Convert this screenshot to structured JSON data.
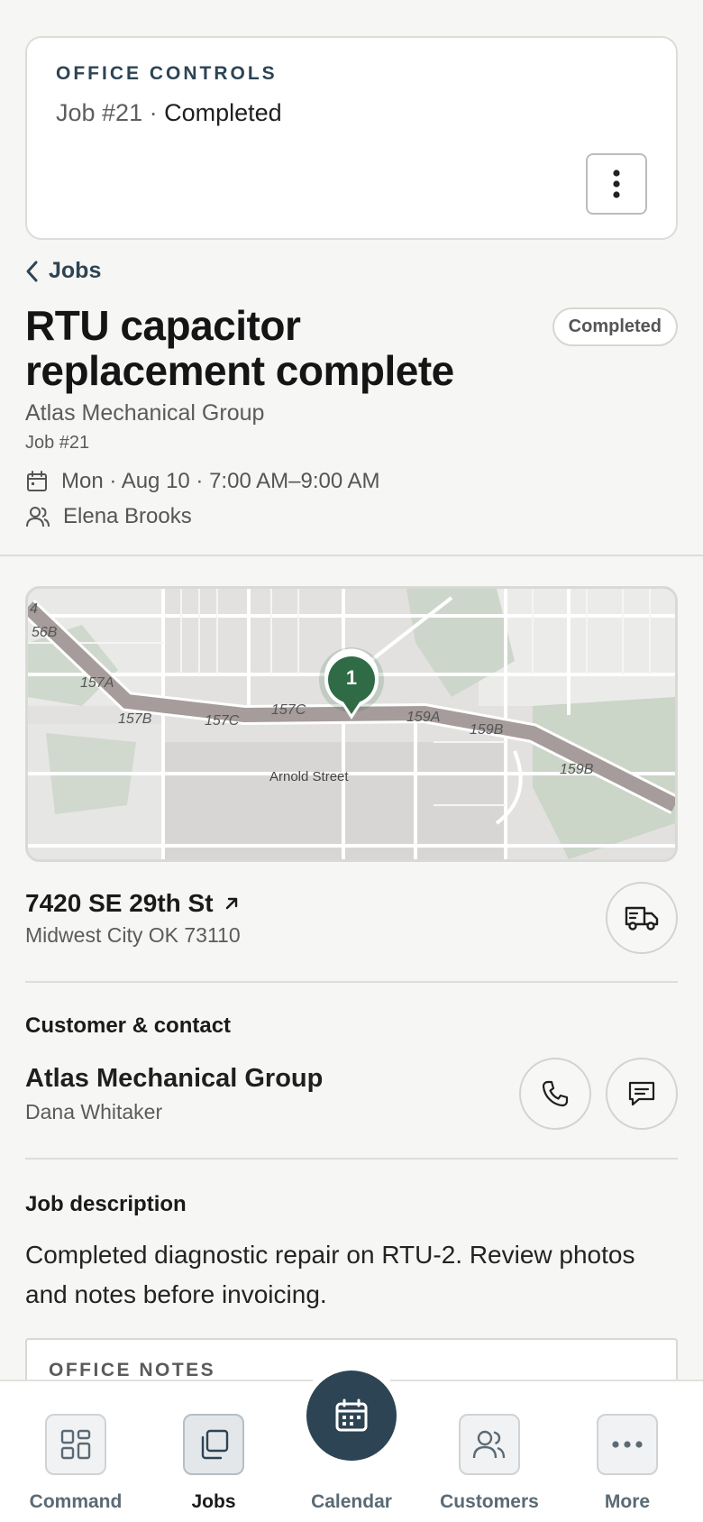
{
  "office": {
    "eyebrow": "OFFICE CONTROLS",
    "job_ref": "Job #21",
    "separator": " · ",
    "status": "Completed"
  },
  "nav": {
    "back_label": "Jobs"
  },
  "job": {
    "title": "RTU capacitor replacement complete",
    "status_badge": "Completed",
    "company": "Atlas Mechanical Group",
    "number": "Job #21",
    "schedule": "Mon · Aug 10 · 7:00 AM–9:00 AM",
    "assignee": "Elena Brooks"
  },
  "map": {
    "pin_label": "1",
    "labels": [
      "4",
      "56B",
      "157A",
      "157B",
      "157C",
      "157C",
      "159A",
      "159B",
      "159B",
      "Arnold Street"
    ],
    "pin_color": "#2f6b45"
  },
  "location": {
    "street": "7420 SE 29th St",
    "city": "Midwest City OK 73110"
  },
  "customer": {
    "section_title": "Customer & contact",
    "name": "Atlas Mechanical Group",
    "contact": "Dana Whitaker"
  },
  "description": {
    "section_title": "Job description",
    "text": "Completed diagnostic repair on RTU-2. Review photos and notes before invoicing."
  },
  "notes": {
    "eyebrow": "OFFICE NOTES"
  },
  "tabbar": {
    "command": "Command",
    "jobs": "Jobs",
    "calendar": "Calendar",
    "customers": "Customers",
    "more": "More"
  },
  "colors": {
    "brand": "#2d4454",
    "background": "#f6f6f4"
  }
}
